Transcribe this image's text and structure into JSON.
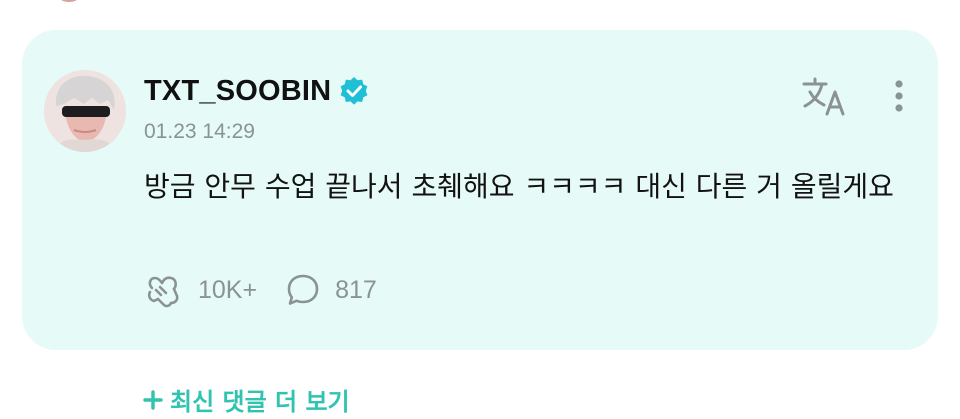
{
  "comment": {
    "username": "TXT_SOOBIN",
    "timestamp": "01.23 14:29",
    "body": "방금 안무 수업 끝나서 초췌해요 ㅋㅋㅋㅋ 대신 다른 거 올릴게요",
    "likes": "10K+",
    "replies": "817",
    "verified": true
  },
  "footer": {
    "more_comments_label": "최신 댓글 더 보기"
  },
  "colors": {
    "card_background": "#e6fbf8",
    "accent": "#2fc3b0",
    "verified_badge": "#1fbfd6",
    "muted_text": "#8a9296"
  },
  "icons": {
    "verified": "verified-badge-icon",
    "translate": "translate-icon",
    "more": "more-vertical-icon",
    "like": "heart-hands-icon",
    "reply": "speech-bubble-icon",
    "plus": "plus-icon"
  }
}
